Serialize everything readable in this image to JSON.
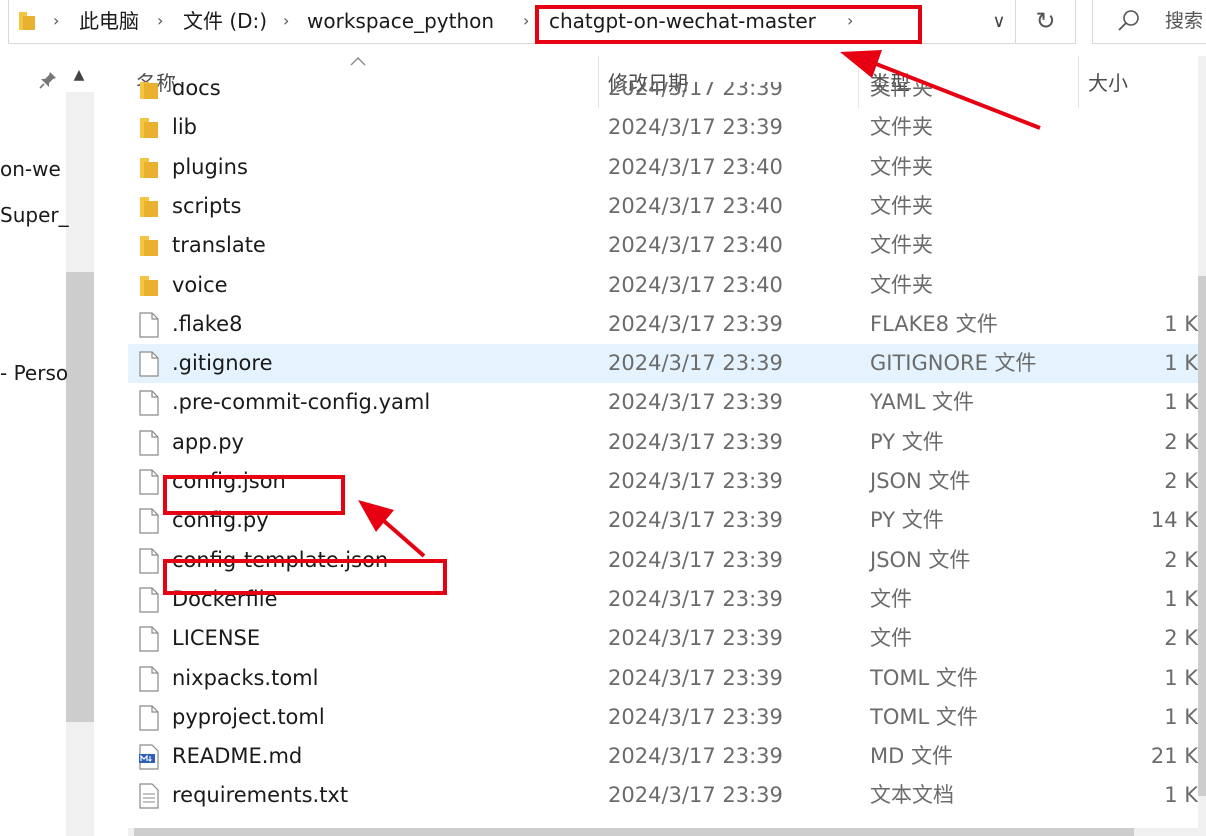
{
  "address_bar": {
    "breadcrumbs": [
      "此电脑",
      "文件 (D:)",
      "workspace_python",
      "chatgpt-on-wechat-master"
    ],
    "search_placeholder": "搜索"
  },
  "nav_pane": {
    "items": [
      "on-we",
      "Super_",
      "- Perso"
    ]
  },
  "columns": {
    "name": "名称",
    "date": "修改日期",
    "type": "类型",
    "size": "大小"
  },
  "files": [
    {
      "name": "docs",
      "date": "2024/3/17 23:39",
      "type": "文件夹",
      "size": "",
      "kind": "folder"
    },
    {
      "name": "lib",
      "date": "2024/3/17 23:39",
      "type": "文件夹",
      "size": "",
      "kind": "folder"
    },
    {
      "name": "plugins",
      "date": "2024/3/17 23:40",
      "type": "文件夹",
      "size": "",
      "kind": "folder"
    },
    {
      "name": "scripts",
      "date": "2024/3/17 23:40",
      "type": "文件夹",
      "size": "",
      "kind": "folder"
    },
    {
      "name": "translate",
      "date": "2024/3/17 23:40",
      "type": "文件夹",
      "size": "",
      "kind": "folder"
    },
    {
      "name": "voice",
      "date": "2024/3/17 23:40",
      "type": "文件夹",
      "size": "",
      "kind": "folder"
    },
    {
      "name": ".flake8",
      "date": "2024/3/17 23:39",
      "type": "FLAKE8 文件",
      "size": "1 K",
      "kind": "file"
    },
    {
      "name": ".gitignore",
      "date": "2024/3/17 23:39",
      "type": "GITIGNORE 文件",
      "size": "1 K",
      "kind": "file"
    },
    {
      "name": ".pre-commit-config.yaml",
      "date": "2024/3/17 23:39",
      "type": "YAML 文件",
      "size": "1 K",
      "kind": "file"
    },
    {
      "name": "app.py",
      "date": "2024/3/17 23:39",
      "type": "PY 文件",
      "size": "2 K",
      "kind": "file"
    },
    {
      "name": "config.json",
      "date": "2024/3/17 23:39",
      "type": "JSON 文件",
      "size": "2 K",
      "kind": "file"
    },
    {
      "name": "config.py",
      "date": "2024/3/17 23:39",
      "type": "PY 文件",
      "size": "14 K",
      "kind": "file"
    },
    {
      "name": "config-template.json",
      "date": "2024/3/17 23:39",
      "type": "JSON 文件",
      "size": "2 K",
      "kind": "file"
    },
    {
      "name": "Dockerfile",
      "date": "2024/3/17 23:39",
      "type": "文件",
      "size": "1 K",
      "kind": "file"
    },
    {
      "name": "LICENSE",
      "date": "2024/3/17 23:39",
      "type": "文件",
      "size": "2 K",
      "kind": "file"
    },
    {
      "name": "nixpacks.toml",
      "date": "2024/3/17 23:39",
      "type": "TOML 文件",
      "size": "1 K",
      "kind": "file"
    },
    {
      "name": "pyproject.toml",
      "date": "2024/3/17 23:39",
      "type": "TOML 文件",
      "size": "1 K",
      "kind": "file"
    },
    {
      "name": "README.md",
      "date": "2024/3/17 23:39",
      "type": "MD 文件",
      "size": "21 K",
      "kind": "markdown"
    },
    {
      "name": "requirements.txt",
      "date": "2024/3/17 23:39",
      "type": "文本文档",
      "size": "1 K",
      "kind": "text"
    }
  ],
  "colors": {
    "annotation": "#e60012",
    "folder": "#f5c542",
    "hover_row": "#e5f3ff"
  }
}
